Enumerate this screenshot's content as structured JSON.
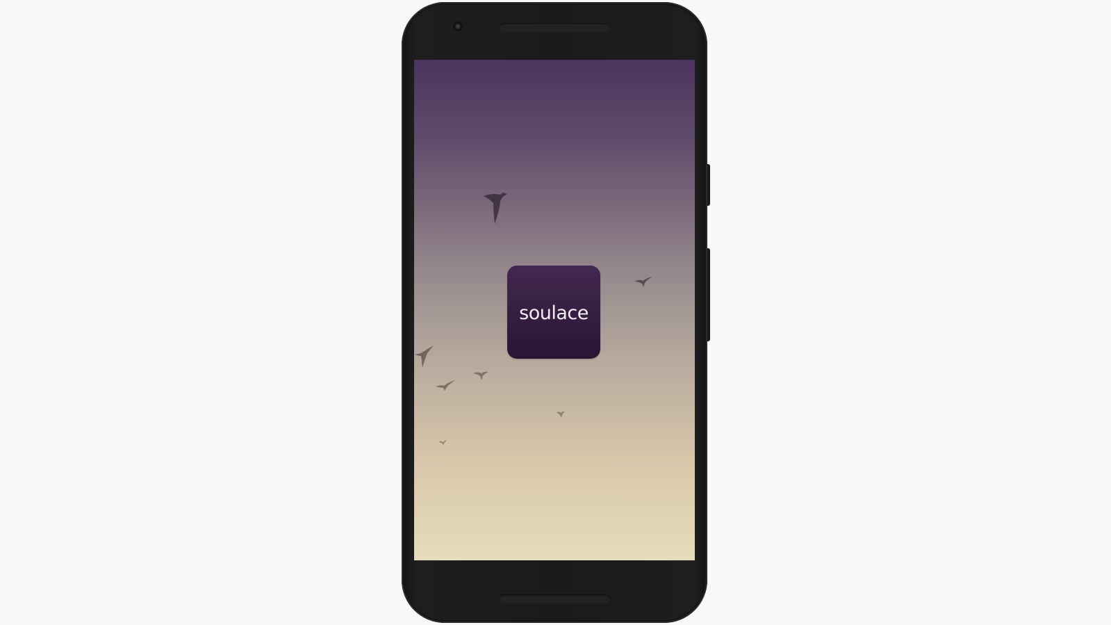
{
  "app": {
    "name": "soulace",
    "icon_colors": {
      "top": "#43284f",
      "bottom": "#2a1535"
    }
  },
  "screen": {
    "type": "splash",
    "background_gradient": [
      "#4b345e",
      "#9a8e8f",
      "#d8c6a9",
      "#e4ddbb"
    ],
    "decorations": [
      "bird-silhouette-icon"
    ]
  },
  "device": {
    "frame_color": "#1a1a1a",
    "page_background": "#f8f8f8"
  }
}
